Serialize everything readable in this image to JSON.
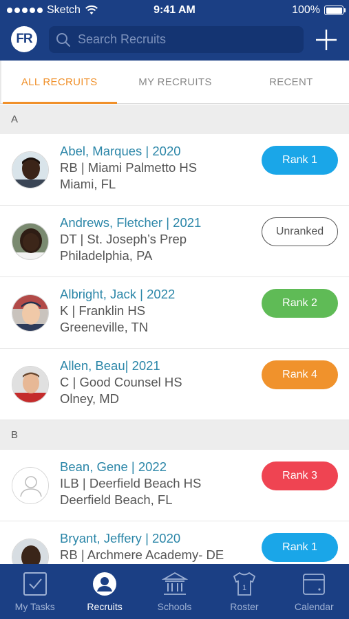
{
  "status_bar": {
    "carrier": "Sketch",
    "time": "9:41 AM",
    "battery": "100%"
  },
  "header": {
    "logo": "FR",
    "search_placeholder": "Search Recruits"
  },
  "tabs": [
    {
      "label": "ALL RECRUITS",
      "active": true
    },
    {
      "label": "MY RECRUITS",
      "active": false
    },
    {
      "label": "RECENT",
      "active": false
    }
  ],
  "sections": [
    {
      "letter": "A",
      "recruits": [
        {
          "name": "Abel, Marques | 2020",
          "position_school": "RB | Miami Palmetto HS",
          "location": "Miami, FL",
          "rank": "Rank 1",
          "rank_color": "#1aa6e8"
        },
        {
          "name": "Andrews, Fletcher | 2021",
          "position_school": "DT | St. Joseph’s Prep",
          "location": "Philadelphia, PA",
          "rank": "Unranked",
          "rank_color": "#ffffff"
        },
        {
          "name": "Albright, Jack | 2022",
          "position_school": "K | Franklin HS",
          "location": "Greeneville, TN",
          "rank": "Rank 2",
          "rank_color": "#5fbb56"
        },
        {
          "name": "Allen, Beau| 2021",
          "position_school": "C | Good Counsel HS",
          "location": "Olney, MD",
          "rank": "Rank 4",
          "rank_color": "#f0922c"
        }
      ]
    },
    {
      "letter": "B",
      "recruits": [
        {
          "name": "Bean, Gene | 2022",
          "position_school": "ILB | Deerfield Beach HS",
          "location": "Deerfield Beach, FL",
          "rank": "Rank 3",
          "rank_color": "#ef4452"
        },
        {
          "name": "Bryant, Jeffery | 2020",
          "position_school": "RB | Archmere Academy- DE",
          "location": "",
          "rank": "Rank 1",
          "rank_color": "#1aa6e8"
        }
      ]
    }
  ],
  "bottom_nav": [
    {
      "label": "My Tasks",
      "icon": "checkbox-icon",
      "active": false
    },
    {
      "label": "Recruits",
      "icon": "person-icon",
      "active": true
    },
    {
      "label": "Schools",
      "icon": "school-building-icon",
      "active": false
    },
    {
      "label": "Roster",
      "icon": "jersey-icon",
      "active": false
    },
    {
      "label": "Calendar",
      "icon": "calendar-icon",
      "active": false
    }
  ]
}
